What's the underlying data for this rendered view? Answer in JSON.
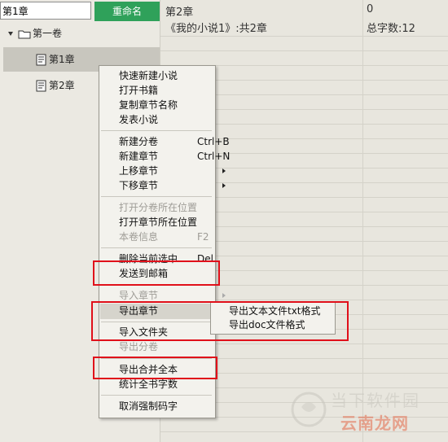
{
  "left_panel": {
    "rename_input_value": "第1章",
    "rename_button": "重命名",
    "tree": {
      "volume": "第一卷",
      "chapters": [
        "第1章",
        "第2章"
      ]
    }
  },
  "right_panel": {
    "current_chapter": "第2章",
    "number": "0",
    "novel_summary": "《我的小说1》:共2章",
    "word_count": "总字数:12"
  },
  "context_menu": {
    "items": [
      {
        "label": "快速新建小说"
      },
      {
        "label": "打开书籍"
      },
      {
        "label": "复制章节名称"
      },
      {
        "label": "发表小说"
      },
      {
        "label": "新建分卷",
        "shortcut": "Ctrl+B"
      },
      {
        "label": "新建章节",
        "shortcut": "Ctrl+N"
      },
      {
        "label": "上移章节"
      },
      {
        "label": "下移章节"
      },
      {
        "label": "打开分卷所在位置"
      },
      {
        "label": "打开章节所在位置"
      },
      {
        "label": "本卷信息",
        "shortcut": "F2"
      },
      {
        "label": "删除当前选中",
        "shortcut": "Del"
      },
      {
        "label": "发送到邮箱"
      },
      {
        "label": "导入章节"
      },
      {
        "label": "导出章节"
      },
      {
        "label": "导入文件夹"
      },
      {
        "label": "导出分卷"
      },
      {
        "label": "导出合并全本"
      },
      {
        "label": "统计全书字数"
      },
      {
        "label": "取消强制码字"
      }
    ]
  },
  "submenu": {
    "items": [
      "导出文本文件txt格式",
      "导出doc文件格式"
    ]
  },
  "watermark": {
    "line1": "当下软件园",
    "line2": "云南龙网"
  },
  "colors": {
    "accent_green": "#2fa15a",
    "highlight_red": "#e0101a"
  }
}
